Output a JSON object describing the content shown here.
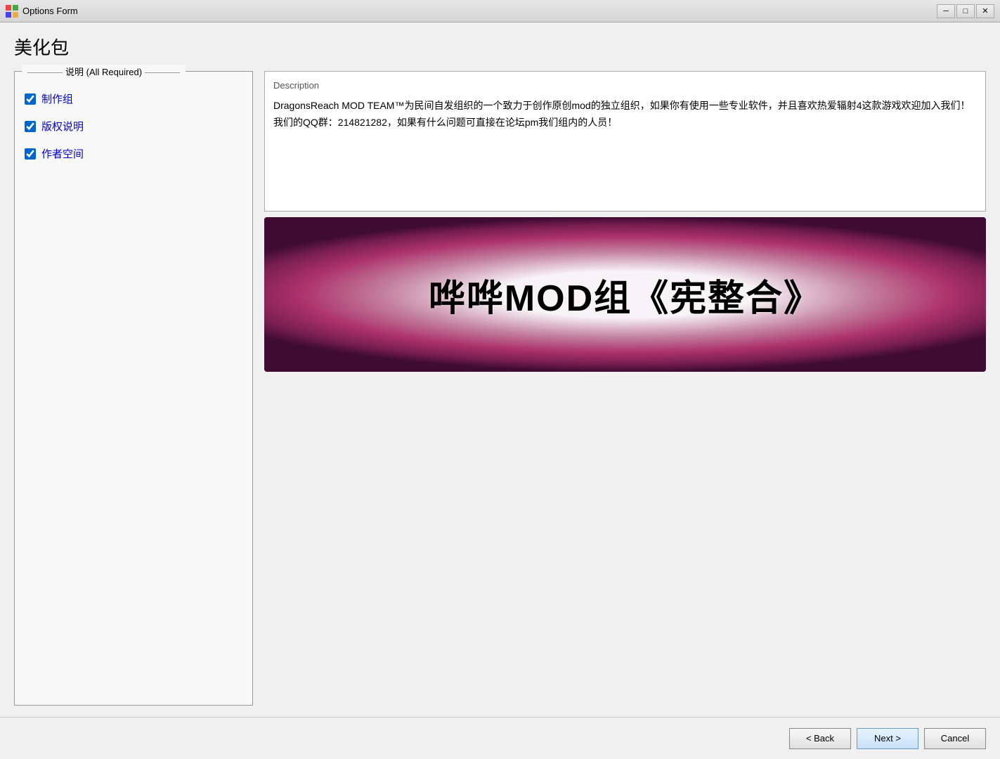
{
  "window": {
    "title": "Options Form",
    "icon": "options-icon"
  },
  "titlebar": {
    "minimize_label": "─",
    "restore_label": "□",
    "close_label": "✕"
  },
  "page": {
    "title": "美化包"
  },
  "left_panel": {
    "group_label": "说明 (All Required)",
    "checkboxes": [
      {
        "id": "cb1",
        "label": "制作组",
        "checked": true
      },
      {
        "id": "cb2",
        "label": "版权说明",
        "checked": true
      },
      {
        "id": "cb3",
        "label": "作者空间",
        "checked": true
      }
    ]
  },
  "right_panel": {
    "description_label": "Description",
    "description_text": "DragonsReach MOD TEAM™为民间自发组织的一个致力于创作原创mod的独立组织，如果你有使用一些专业软件，并且喜欢热爱辐射4这款游戏欢迎加入我们！我们的QQ群：214821282，如果有什么问题可直接在论坛pm我们组内的人员！",
    "banner_text": "哗哗MOD组《宪整合》"
  },
  "footer": {
    "back_label": "< Back",
    "next_label": "Next >",
    "cancel_label": "Cancel"
  }
}
